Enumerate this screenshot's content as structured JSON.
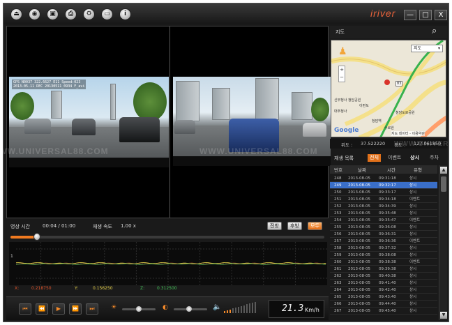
{
  "window": {
    "brand": "iriver",
    "toolbar_icons": [
      "eject-icon",
      "camera-icon",
      "save-icon",
      "print-icon",
      "settings-icon",
      "window-icon",
      "info-icon"
    ],
    "minimize": "—",
    "maximize": "□",
    "close": "X"
  },
  "video": {
    "osd_line1": "GPS  N0037 322.6627 E11  Speed:023",
    "osd_line2": "2013-05-11  REC 20130511_0934 F_avi"
  },
  "watermark": "WWW.UNIVERSAL88.COM",
  "playback": {
    "time_label": "영상 시간",
    "time_value": "00:04 / 01:00",
    "speed_label": "재생 속도",
    "speed_value": "1.00 x",
    "progress_fraction": 0.085,
    "view_buttons": [
      "전방",
      "후방",
      "모두"
    ]
  },
  "accelerometer": {
    "y_axis_label": "1",
    "x_label": "X:",
    "x_value": "0.218750",
    "y_label": "Y:",
    "y_value": "0.156250",
    "z_label": "Z:",
    "z_value": "0.312500",
    "series_colors": {
      "x": "#e0532a",
      "y": "#e8d24a",
      "z": "#45c35a"
    }
  },
  "controls": {
    "buttons": [
      "⏮",
      "⏪",
      "▶",
      "⏩",
      "⏭"
    ],
    "brightness_level": 0.5,
    "contrast_level": 0.45,
    "speed_display": "21.3",
    "speed_unit": "Km/h"
  },
  "map": {
    "title": "지도",
    "map_type": "지도",
    "route_marker": "83",
    "labels": [
      "신무청사 청담공원",
      "이편도",
      "대주청사",
      "청담도로공원",
      "청담역",
      "수로원"
    ],
    "google": "Google",
    "copyright": "지도 데이터 - 이용약관"
  },
  "coords": {
    "lat_label": "위도 :",
    "lat_value": "37.522220",
    "lon_label": "경도 :",
    "lon_value": "127.061850"
  },
  "list": {
    "title": "재생 목록",
    "tabs": [
      "전체",
      "이벤트",
      "상시",
      "주차"
    ],
    "columns": [
      "번호",
      "날짜",
      "시간",
      "유형"
    ],
    "rows": [
      {
        "no": "248",
        "date": "2013-08-05",
        "time": "09:31:18",
        "type": "상시"
      },
      {
        "no": "249",
        "date": "2013-08-05",
        "time": "09:32:17",
        "type": "상시",
        "selected": true
      },
      {
        "no": "250",
        "date": "2013-08-05",
        "time": "09:33:17",
        "type": "상시"
      },
      {
        "no": "251",
        "date": "2013-08-05",
        "time": "09:34:18",
        "type": "이벤트"
      },
      {
        "no": "252",
        "date": "2013-08-05",
        "time": "09:34:39",
        "type": "상시"
      },
      {
        "no": "253",
        "date": "2013-08-05",
        "time": "09:35:48",
        "type": "상시"
      },
      {
        "no": "254",
        "date": "2013-08-05",
        "time": "09:35:47",
        "type": "이벤트"
      },
      {
        "no": "255",
        "date": "2013-08-05",
        "time": "09:36:08",
        "type": "상시"
      },
      {
        "no": "256",
        "date": "2013-08-05",
        "time": "09:36:31",
        "type": "상시"
      },
      {
        "no": "257",
        "date": "2013-08-05",
        "time": "09:36:36",
        "type": "이벤트"
      },
      {
        "no": "258",
        "date": "2013-08-05",
        "time": "09:37:32",
        "type": "상시"
      },
      {
        "no": "259",
        "date": "2013-08-05",
        "time": "09:38:08",
        "type": "상시"
      },
      {
        "no": "260",
        "date": "2013-08-05",
        "time": "09:38:38",
        "type": "이벤트"
      },
      {
        "no": "261",
        "date": "2013-08-05",
        "time": "09:39:38",
        "type": "상시"
      },
      {
        "no": "262",
        "date": "2013-08-05",
        "time": "09:40:38",
        "type": "상시"
      },
      {
        "no": "263",
        "date": "2013-08-05",
        "time": "09:41:40",
        "type": "상시"
      },
      {
        "no": "264",
        "date": "2013-08-05",
        "time": "09:42:40",
        "type": "상시"
      },
      {
        "no": "265",
        "date": "2013-08-05",
        "time": "09:43:40",
        "type": "상시"
      },
      {
        "no": "266",
        "date": "2013-08-05",
        "time": "09:44:40",
        "type": "상시"
      },
      {
        "no": "267",
        "date": "2013-08-05",
        "time": "09:45:40",
        "type": "상시"
      }
    ]
  }
}
